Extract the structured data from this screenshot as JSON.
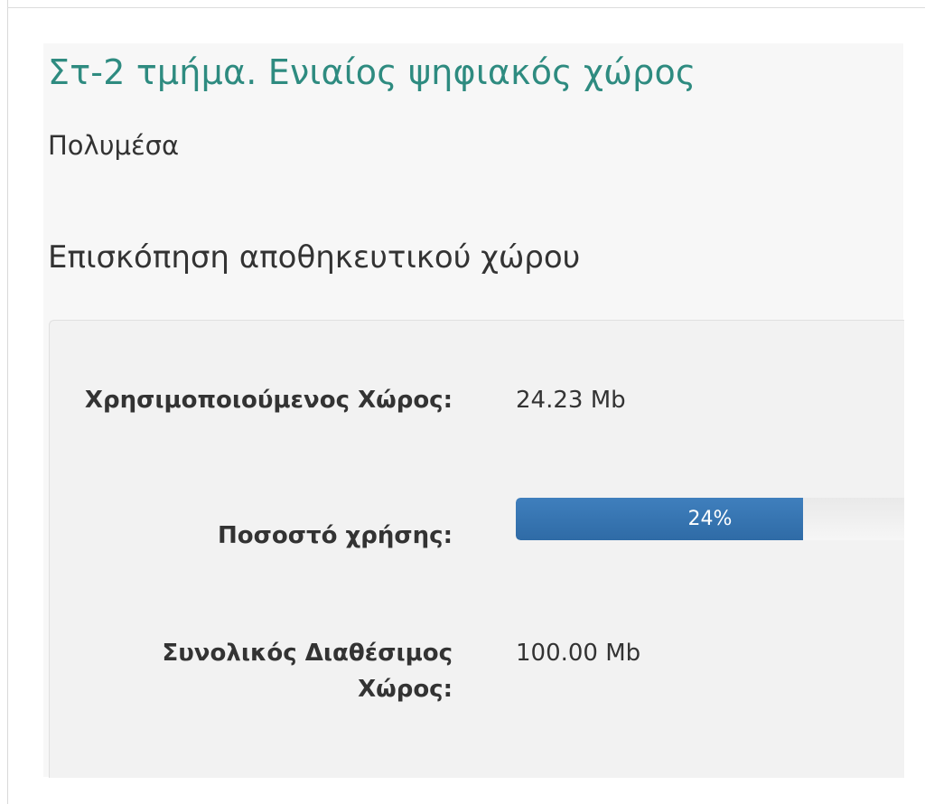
{
  "page": {
    "course_title": "Στ-2 τμήμα. Ενιαίος ψηφιακός χώρος",
    "module_name": "Πολυμέσα",
    "section_heading": "Επισκόπηση αποθηκευτικού χώρου"
  },
  "storage": {
    "used_label": "Χρησιμοποιούμενος Χώρος:",
    "used_value": "24.23 Mb",
    "usage_label": "Ποσοστό χρήσης:",
    "usage_percent": 24,
    "usage_text": "24%",
    "total_label": "Συνολικός Διαθέσιμος Χώρος:",
    "total_value": "100.00 Mb"
  },
  "colors": {
    "title": "#2e8b80",
    "progress_fill": "#3375b3",
    "progress_track": "#eeeeee"
  }
}
